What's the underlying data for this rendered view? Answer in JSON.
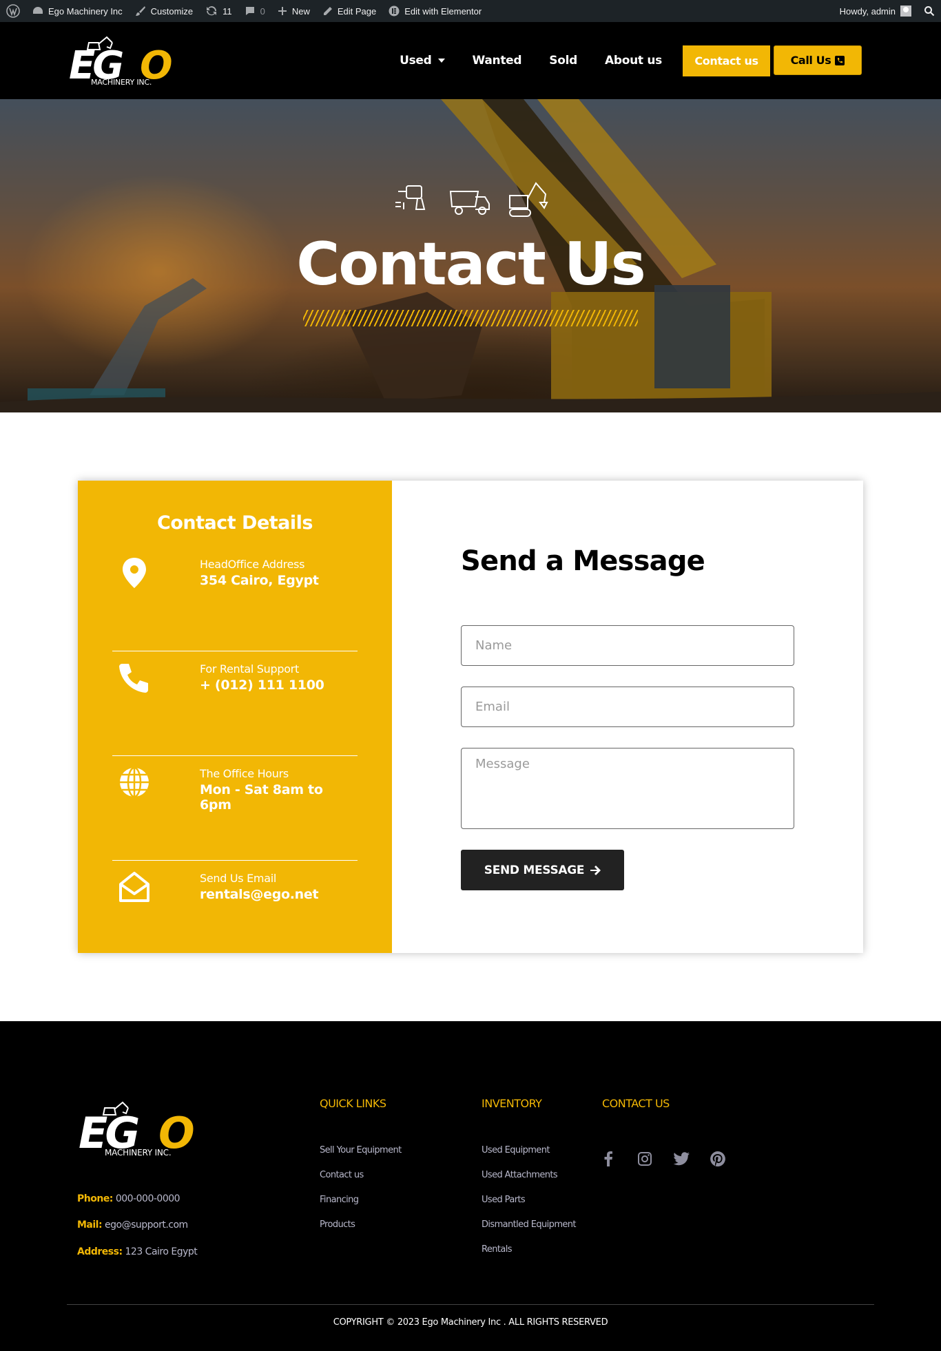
{
  "adminbar": {
    "site_name": "Ego Machinery Inc",
    "customize": "Customize",
    "updates_count": "11",
    "comments_count": "0",
    "new": "New",
    "edit_page": "Edit Page",
    "edit_elementor": "Edit with Elementor",
    "howdy": "Howdy, admin"
  },
  "header": {
    "logo_text": "EGO",
    "logo_sub": "MACHINERY INC.",
    "nav": [
      {
        "label": "Used",
        "has_dropdown": true
      },
      {
        "label": "Wanted"
      },
      {
        "label": "Sold"
      },
      {
        "label": "About us"
      }
    ],
    "contact_button": "Contact us",
    "call_button": "Call Us"
  },
  "hero": {
    "title": "Contact Us",
    "icons": [
      "drill-icon",
      "dump-truck-icon",
      "excavator-icon"
    ]
  },
  "details": {
    "title": "Contact Details",
    "items": [
      {
        "icon": "location-pin-icon",
        "label": "HeadOffice Address",
        "value": "354 Cairo, Egypt"
      },
      {
        "icon": "phone-icon",
        "label": "For Rental Support",
        "value": "+ (012) 111 1100"
      },
      {
        "icon": "globe-icon",
        "label": "The Office Hours",
        "value": "Mon - Sat 8am to 6pm"
      },
      {
        "icon": "envelope-open-icon",
        "label": "Send Us Email",
        "value": "rentals@ego.net"
      }
    ]
  },
  "form": {
    "title": "Send a Message",
    "name_placeholder": "Name",
    "email_placeholder": "Email",
    "message_placeholder": "Message",
    "submit": "SEND MESSAGE"
  },
  "footer": {
    "logo_text": "EGO",
    "logo_sub": "MACHINERY INC.",
    "phone_label": "Phone:",
    "phone": "000-000-0000",
    "mail_label": "Mail:",
    "mail": "ego@support.com",
    "address_label": "Address:",
    "address": "123 Cairo Egypt",
    "quick_links": {
      "heading": "QUICK LINKS",
      "links": [
        "Sell Your Equipment",
        "Contact us",
        "Financing",
        "Products"
      ]
    },
    "inventory": {
      "heading": "INVENTORY",
      "links": [
        "Used Equipment",
        "Used Attachments",
        "Used Parts",
        "Dismantled Equipment",
        "Rentals"
      ]
    },
    "contact": {
      "heading": "CONTACT US",
      "socials": [
        "facebook-icon",
        "instagram-icon",
        "twitter-icon",
        "pinterest-icon"
      ]
    },
    "copyright": "COPYRIGHT © 2023 Ego Machinery Inc . ALL RIGHTS RESERVED"
  },
  "colors": {
    "accent": "#f2b705",
    "dark": "#000000",
    "admin_bar": "#1d2327",
    "button_dark": "#222222"
  }
}
